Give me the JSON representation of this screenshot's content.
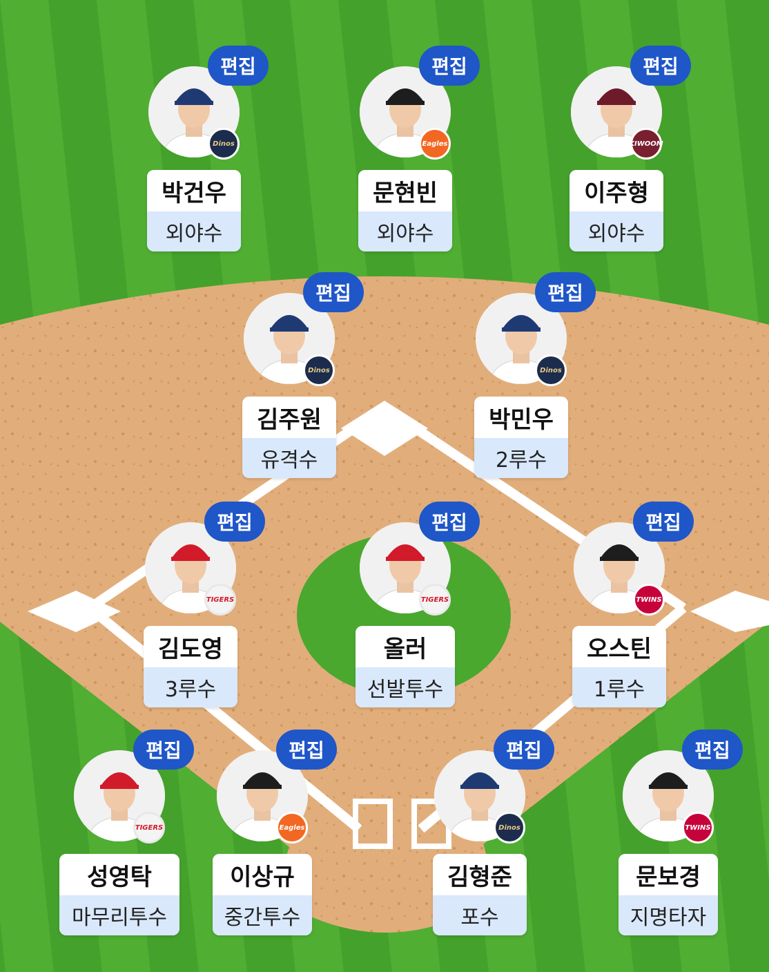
{
  "edit_label": "편집",
  "colors": {
    "edit_button": "#1f56c8",
    "position_band": "#d9e8fb",
    "grass": "#4aa82f",
    "infield_dirt": "#e0ac79"
  },
  "players": [
    {
      "name": "박건우",
      "position": "외야수",
      "team_logo": "dinos-logo",
      "team_text": "Dinos",
      "cap": "navy"
    },
    {
      "name": "문현빈",
      "position": "외야수",
      "team_logo": "eagles-logo",
      "team_text": "Eagles",
      "cap": "black"
    },
    {
      "name": "이주형",
      "position": "외야수",
      "team_logo": "kiwoom-logo",
      "team_text": "KIWOOM",
      "cap": "maroon"
    },
    {
      "name": "김주원",
      "position": "유격수",
      "team_logo": "dinos-logo",
      "team_text": "Dinos",
      "cap": "navy"
    },
    {
      "name": "박민우",
      "position": "2루수",
      "team_logo": "dinos-logo",
      "team_text": "Dinos",
      "cap": "navy"
    },
    {
      "name": "김도영",
      "position": "3루수",
      "team_logo": "tigers-logo",
      "team_text": "TIGERS",
      "cap": "red"
    },
    {
      "name": "올러",
      "position": "선발투수",
      "team_logo": "tigers-logo",
      "team_text": "TIGERS",
      "cap": "red"
    },
    {
      "name": "오스틴",
      "position": "1루수",
      "team_logo": "twins-logo",
      "team_text": "TWINS",
      "cap": "black"
    },
    {
      "name": "성영탁",
      "position": "마무리투수",
      "team_logo": "tigers-logo",
      "team_text": "TIGERS",
      "cap": "red"
    },
    {
      "name": "이상규",
      "position": "중간투수",
      "team_logo": "eagles-logo",
      "team_text": "Eagles",
      "cap": "black"
    },
    {
      "name": "김형준",
      "position": "포수",
      "team_logo": "dinos-logo",
      "team_text": "Dinos",
      "cap": "navy"
    },
    {
      "name": "문보경",
      "position": "지명타자",
      "team_logo": "twins-logo",
      "team_text": "TWINS",
      "cap": "black"
    }
  ]
}
